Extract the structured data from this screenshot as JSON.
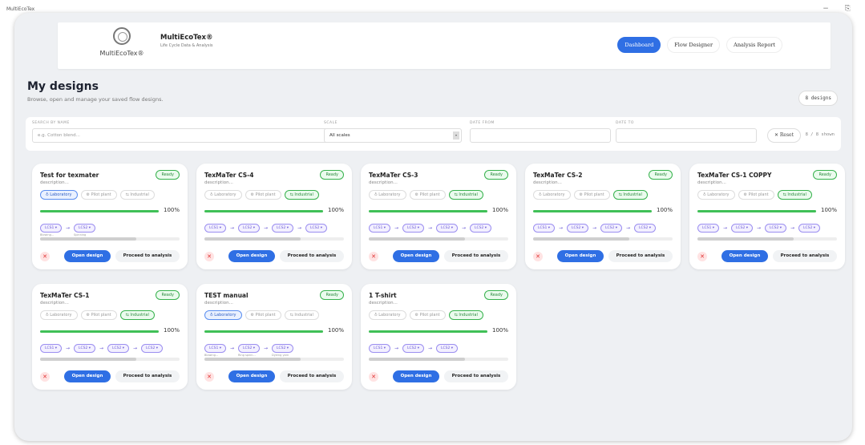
{
  "window": {
    "title": "MultiEcoTex",
    "minimize": "−",
    "restore": "⎘"
  },
  "header": {
    "logo_text": "MultiEcoTex®",
    "brand_title": "MultiEcoTex®",
    "brand_subtitle": "Life Cycle Data & Analysis",
    "nav": [
      "Dashboard",
      "Flow Designer",
      "Analysis Report"
    ]
  },
  "page": {
    "title": "My designs",
    "subtitle": "Browse, open and manage your saved flow designs.",
    "count_chip": "8 designs"
  },
  "filters": {
    "search_label": "SEARCH BY NAME",
    "search_placeholder": "e.g. Cotton blend...",
    "scale_label": "SCALE",
    "scale_value": "All scales",
    "date_from_label": "DATE FROM",
    "date_to_label": "DATE TO",
    "reset": "✕ Reset",
    "shown": "8 / 8 shown"
  },
  "card_labels": {
    "ready": "Ready",
    "description": "description...",
    "lab": "♁ Laboratory",
    "pilot": "⚙ Pilot plant",
    "industrial": "⇆ Industrial",
    "open": "Open design",
    "proceed": "Proceed to analysis",
    "delete": "✕"
  },
  "cards": [
    {
      "title": "Test for texmater",
      "progress": 100,
      "pct": "100%",
      "active_scale": "lab",
      "nodes": [
        "LCS1 ▾",
        "LCS2 ▾"
      ],
      "subs": [
        "Blowing...",
        "Spinning"
      ]
    },
    {
      "title": "TexMaTer CS-4",
      "progress": 100,
      "pct": "100%",
      "active_scale": "industrial",
      "nodes": [
        "LCS1 ▾",
        "LCS2 ▾",
        "LCS2 ▾",
        "LCS2 ▾"
      ],
      "subs": []
    },
    {
      "title": "TexMaTer CS-3",
      "progress": 100,
      "pct": "100%",
      "active_scale": "industrial",
      "nodes": [
        "LCS1 ▾",
        "LCS2 ▾",
        "LCS2 ▾",
        "LCS2 ▾"
      ],
      "subs": []
    },
    {
      "title": "TexMaTer CS-2",
      "progress": 100,
      "pct": "100%",
      "active_scale": "industrial",
      "nodes": [
        "LCS1 ▾",
        "LCS2 ▾",
        "LCS2 ▾",
        "LCS2 ▾"
      ],
      "subs": []
    },
    {
      "title": "TexMaTer CS-1 COPPY",
      "progress": 100,
      "pct": "100%",
      "active_scale": "industrial",
      "nodes": [
        "LCS1 ▾",
        "LCS2 ▾",
        "LCS2 ▾",
        "LCS2 ▾"
      ],
      "subs": []
    },
    {
      "title": "TexMaTer CS-1",
      "progress": 100,
      "pct": "100%",
      "active_scale": "industrial",
      "nodes": [
        "LCS1 ▾",
        "LCS2 ▾",
        "LCS2 ▾",
        "LCS2 ▾"
      ],
      "subs": []
    },
    {
      "title": "TEST manual",
      "progress": 100,
      "pct": "100%",
      "active_scale": "lab",
      "nodes": [
        "LCS1 ▾",
        "LCS2 ▾",
        "LCS2 ▾"
      ],
      "subs": [
        "Blowing...",
        "Ring spinn...",
        "Dyeing yarn"
      ]
    },
    {
      "title": "1 T-shirt",
      "progress": 100,
      "pct": "100%",
      "active_scale": "industrial",
      "nodes": [
        "LCS1 ▾",
        "LCS2 ▾",
        "LCS2 ▾"
      ],
      "subs": []
    }
  ]
}
